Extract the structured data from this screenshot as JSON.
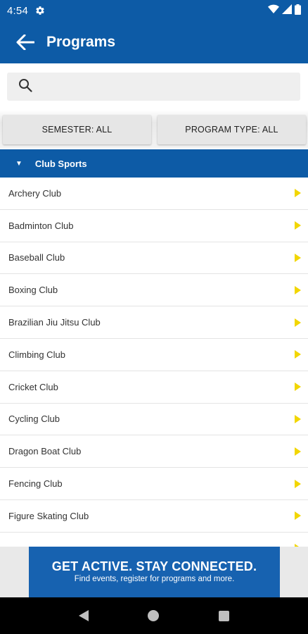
{
  "status_bar": {
    "time": "4:54"
  },
  "app_bar": {
    "title": "Programs"
  },
  "search": {
    "placeholder": ""
  },
  "filters": {
    "semester_label": "SEMESTER: ALL",
    "program_type_label": "PROGRAM TYPE: ALL"
  },
  "section": {
    "title": "Club Sports"
  },
  "list": {
    "items": [
      {
        "label": "Archery Club"
      },
      {
        "label": "Badminton Club"
      },
      {
        "label": "Baseball Club"
      },
      {
        "label": "Boxing Club"
      },
      {
        "label": "Brazilian Jiu Jitsu Club"
      },
      {
        "label": "Climbing Club"
      },
      {
        "label": "Cricket Club"
      },
      {
        "label": "Cycling Club"
      },
      {
        "label": "Dragon Boat Club"
      },
      {
        "label": "Fencing Club"
      },
      {
        "label": "Figure Skating Club"
      },
      {
        "label": ""
      }
    ]
  },
  "banner": {
    "headline": "GET ACTIVE.  STAY CONNECTED.",
    "subtext": "Find events, register for programs and more."
  },
  "colors": {
    "primary": "#0d5ba6",
    "arrow": "#f2d600",
    "banner": "#1762b0"
  }
}
